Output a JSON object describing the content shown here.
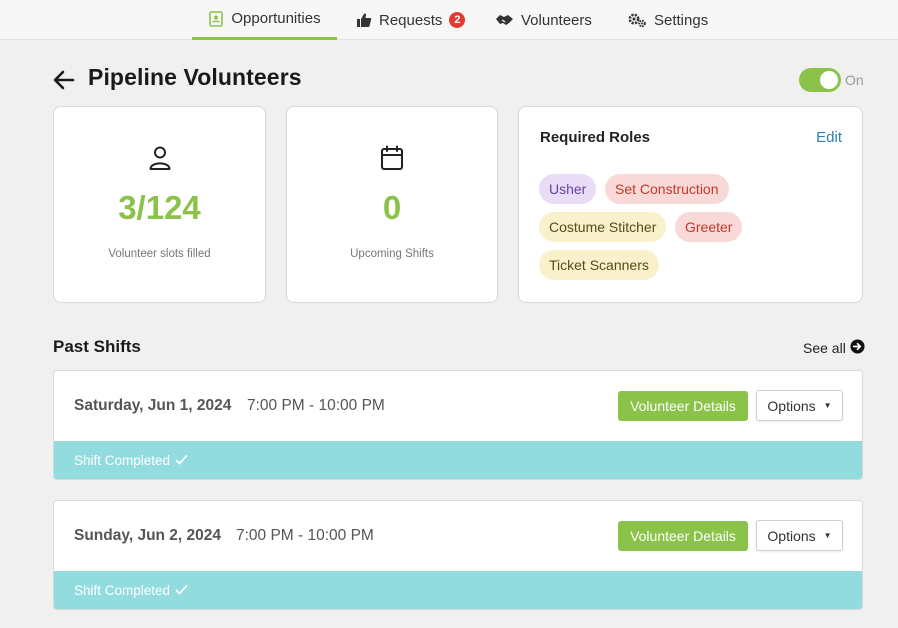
{
  "nav": {
    "tabs": [
      {
        "label": "Opportunities",
        "icon": "contact-book-icon",
        "active": true
      },
      {
        "label": "Requests",
        "icon": "thumbs-up-icon",
        "badge": "2"
      },
      {
        "label": "Volunteers",
        "icon": "handshake-icon"
      },
      {
        "label": "Settings",
        "icon": "gears-icon"
      }
    ]
  },
  "header": {
    "title": "Pipeline Volunteers",
    "toggle_label": "On",
    "toggle_on": true
  },
  "stats": [
    {
      "icon": "user-icon",
      "value": "3/124",
      "label": "Volunteer slots filled"
    },
    {
      "icon": "calendar-icon",
      "value": "0",
      "label": "Upcoming Shifts"
    }
  ],
  "roles": {
    "title": "Required Roles",
    "edit_label": "Edit",
    "chips": [
      {
        "label": "Usher",
        "color": "#e9dcf7"
      },
      {
        "label": "Set Construction",
        "color": "#f8d9d7"
      },
      {
        "label": "Costume Stitcher",
        "color": "#f8f1cb"
      },
      {
        "label": "Greeter",
        "color": "#f8d9d7"
      },
      {
        "label": "Ticket Scanners",
        "color": "#f8f1cb"
      }
    ]
  },
  "past_shifts": {
    "title": "Past Shifts",
    "see_all": "See all",
    "items": [
      {
        "date": "Saturday, Jun 1, 2024",
        "time": "7:00 PM - 10:00 PM",
        "details_label": "Volunteer Details",
        "options_label": "Options",
        "status": "Shift Completed"
      },
      {
        "date": "Sunday, Jun 2, 2024",
        "time": "7:00 PM - 10:00 PM",
        "details_label": "Volunteer Details",
        "options_label": "Options",
        "status": "Shift Completed"
      }
    ]
  },
  "colors": {
    "accent": "#8bc34a",
    "link": "#2e7fb8",
    "status_bar": "#92dce0",
    "badge": "#e53935"
  }
}
